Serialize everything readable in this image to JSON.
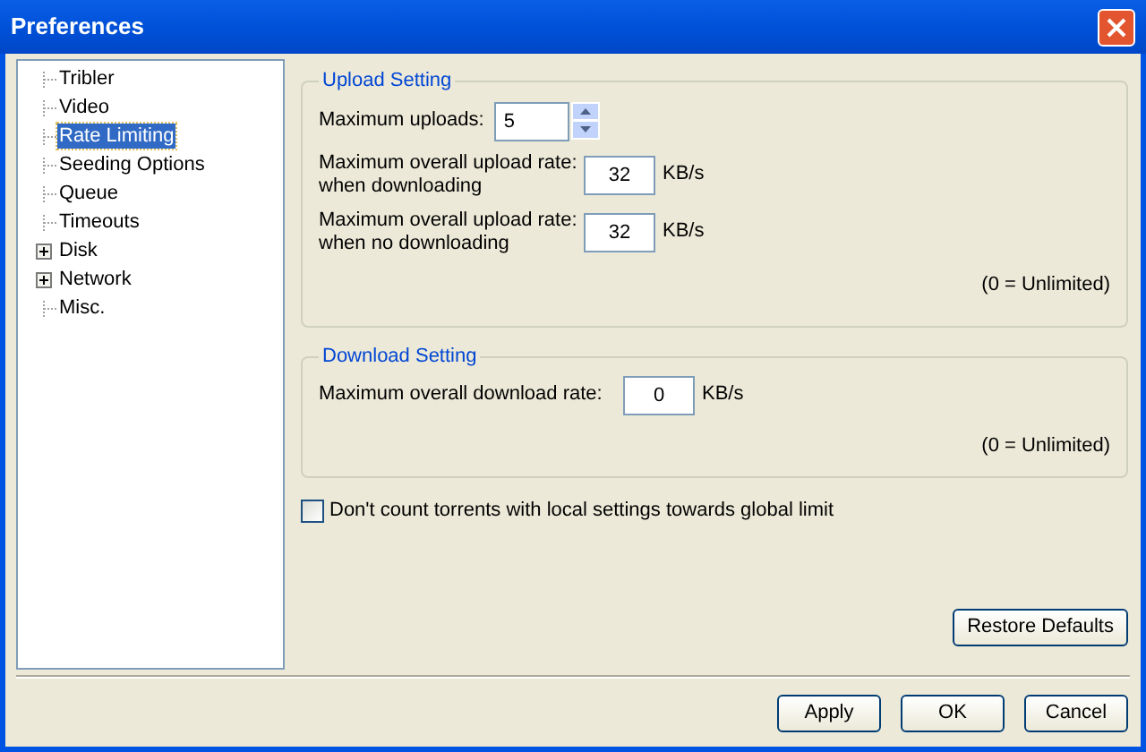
{
  "window": {
    "title": "Preferences"
  },
  "tree": [
    {
      "label": "Tribler",
      "kind": "leaf",
      "selected": false
    },
    {
      "label": "Video",
      "kind": "leaf",
      "selected": false
    },
    {
      "label": "Rate Limiting",
      "kind": "leaf",
      "selected": true
    },
    {
      "label": "Seeding Options",
      "kind": "leaf",
      "selected": false
    },
    {
      "label": "Queue",
      "kind": "leaf",
      "selected": false
    },
    {
      "label": "Timeouts",
      "kind": "leaf",
      "selected": false
    },
    {
      "label": "Disk",
      "kind": "group",
      "selected": false,
      "expanded": false
    },
    {
      "label": "Network",
      "kind": "group",
      "selected": false,
      "expanded": false
    },
    {
      "label": "Misc.",
      "kind": "leaf",
      "selected": false
    }
  ],
  "upload_setting": {
    "title": "Upload Setting",
    "max_uploads_label": "Maximum uploads:",
    "max_uploads_value": "5",
    "rates": [
      {
        "label": "Maximum overall upload rate:",
        "sublabel": "when downloading",
        "value": "32",
        "unit": "KB/s"
      },
      {
        "label": "Maximum overall upload rate:",
        "sublabel": "when no downloading",
        "value": "32",
        "unit": "KB/s"
      }
    ],
    "note": "(0 = Unlimited)"
  },
  "download_setting": {
    "title": "Download Setting",
    "label": "Maximum overall download rate:",
    "value": "0",
    "unit": "KB/s",
    "note": "(0 = Unlimited)"
  },
  "local_settings_checkbox": {
    "label": "Don't count torrents with local settings towards global limit",
    "checked": false
  },
  "restore_button": "Restore Defaults",
  "buttons": [
    "Apply",
    "OK",
    "Cancel"
  ]
}
